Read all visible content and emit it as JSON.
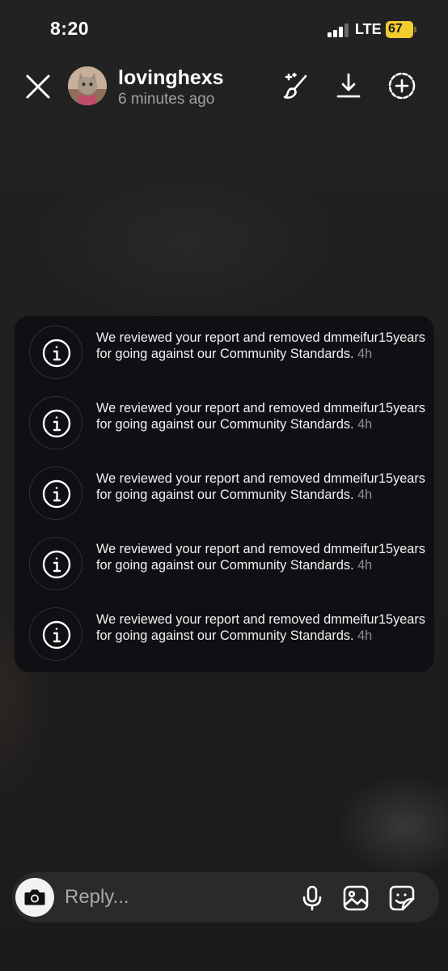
{
  "status_bar": {
    "time": "8:20",
    "network": "LTE",
    "battery": "67",
    "signal_bars_active": 3,
    "signal_bars_total": 4,
    "battery_color": "#f2cc2f"
  },
  "story_header": {
    "username": "lovinghexs",
    "time_ago": "6 minutes ago",
    "icons": [
      "close-icon",
      "sparkle-brush-icon",
      "download-icon",
      "add-to-story-icon"
    ]
  },
  "notifications": [
    {
      "icon": "info-icon",
      "message": "We reviewed your report and removed dmmeifur15years for going against our Community Standards.",
      "timestamp": "4h"
    },
    {
      "icon": "info-icon",
      "message": "We reviewed your report and removed dmmeifur15years for going against our Community Standards.",
      "timestamp": "4h"
    },
    {
      "icon": "info-icon",
      "message": "We reviewed your report and removed dmmeifur15years for going against our Community Standards.",
      "timestamp": "4h"
    },
    {
      "icon": "info-icon",
      "message": "We reviewed your report and removed dmmeifur15years for going against our Community Standards.",
      "timestamp": "4h"
    },
    {
      "icon": "info-icon",
      "message": "We reviewed your report and removed dmmeifur15years for going against our Community Standards.",
      "timestamp": "4h"
    }
  ],
  "reply_bar": {
    "placeholder": "Reply...",
    "icons": [
      "camera-icon",
      "microphone-icon",
      "gallery-icon",
      "sticker-icon"
    ]
  }
}
